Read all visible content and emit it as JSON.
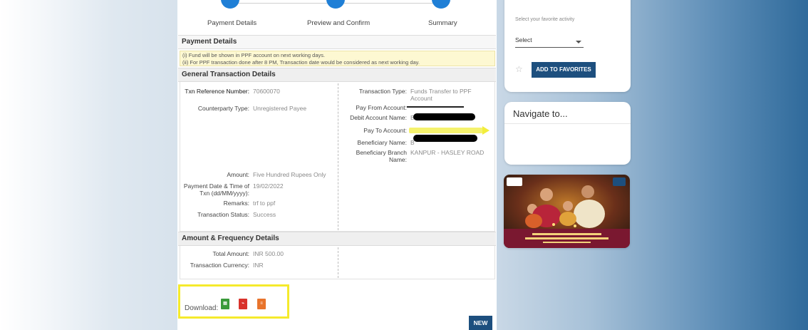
{
  "steps": [
    {
      "label": "Payment Details"
    },
    {
      "label": "Preview and Confirm"
    },
    {
      "label": "Summary"
    }
  ],
  "payment_details": {
    "title": "Payment Details",
    "notes": [
      "(i) Fund will be shown in PPF account on next working days.",
      "(ii) For PPF transaction done after 8 PM, Transaction date would be considered as next working day."
    ]
  },
  "general": {
    "title": "General Transaction Details",
    "left": [
      {
        "label": "Txn Reference Number:",
        "value": "70600070"
      },
      {
        "label": "Counterparty Type:",
        "value": "Unregistered Payee"
      },
      {
        "label": "Amount:",
        "value": "Five Hundred Rupees Only"
      },
      {
        "label": "Payment Date & Time of Txn (dd/MM/yyyy):",
        "value": "19/02/2022"
      },
      {
        "label": "Remarks:",
        "value": "trf to ppf"
      },
      {
        "label": "Transaction Status:",
        "value": "Success"
      }
    ],
    "right": [
      {
        "label": "Transaction Type:",
        "value": "Funds Transfer to PPF Account"
      },
      {
        "label": "Pay From Account:",
        "value": ""
      },
      {
        "label": "Debit Account Name:",
        "value": "B"
      },
      {
        "label": "Pay To Account:",
        "value": ""
      },
      {
        "label": "Beneficiary Name:",
        "value": "B"
      },
      {
        "label": "Beneficiary Branch Name:",
        "value": "KANPUR - HASLEY ROAD"
      }
    ]
  },
  "amount_freq": {
    "title": "Amount & Frequency Details",
    "rows": [
      {
        "label": "Total Amount:",
        "value": "INR 500.00"
      },
      {
        "label": "Transaction Currency:",
        "value": "INR"
      }
    ]
  },
  "download": {
    "label": "Download:",
    "icons": [
      "excel-file-icon",
      "pdf-file-icon",
      "text-file-icon"
    ],
    "colors": [
      "#3a9a3a",
      "#d9322b",
      "#e8742c"
    ]
  },
  "new_button": "NEW",
  "favorites": {
    "hint": "Select your favorite activity",
    "select_value": "Select",
    "button": "ADD TO FAVORITES"
  },
  "navigate": {
    "title": "Navigate to..."
  },
  "colors": {
    "primary": "#1d4f7e",
    "step": "#1f7fd6",
    "highlight": "#f5ea2c"
  }
}
